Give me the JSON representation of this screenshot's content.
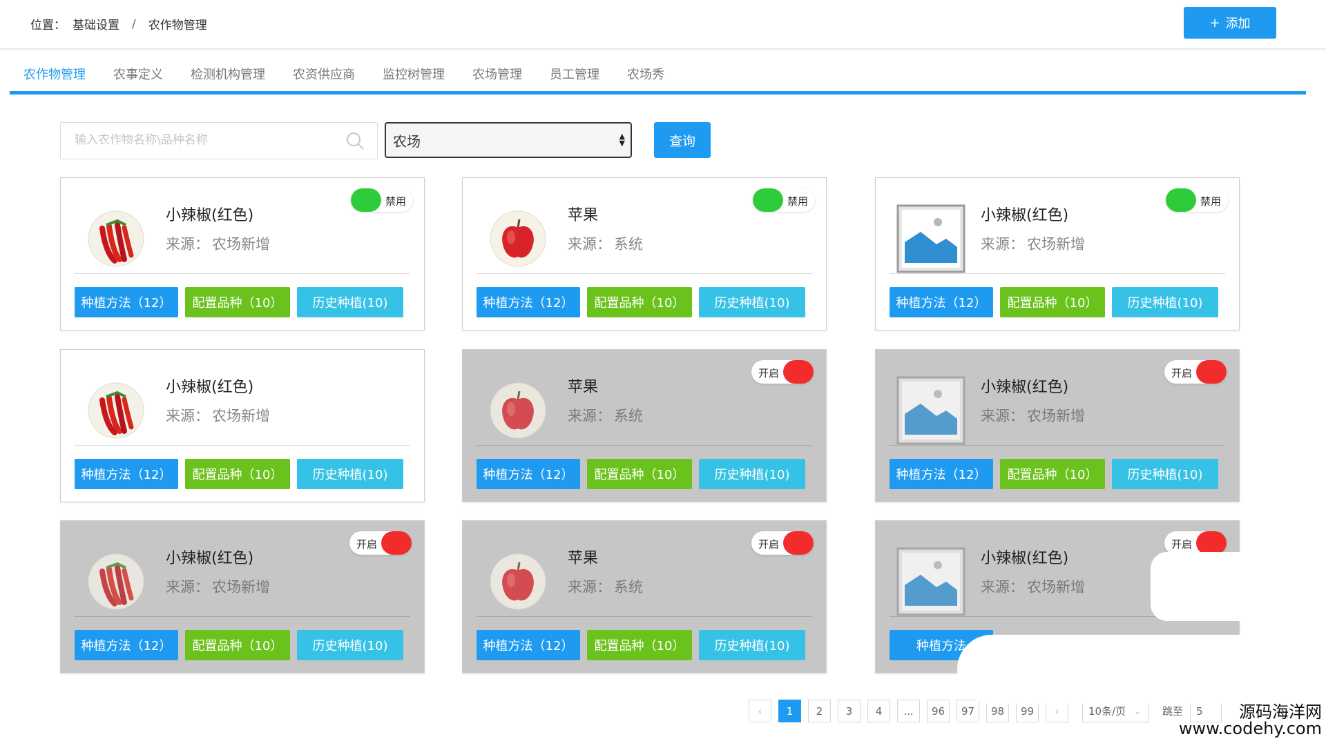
{
  "breadcrumb": {
    "prefix": "位置：",
    "items": [
      "基础设置",
      "农作物管理"
    ],
    "separator": "/"
  },
  "header": {
    "add_icon": "+",
    "add_label": "添加"
  },
  "tabs": [
    "农作物管理",
    "农事定义",
    "检测机构管理",
    "农资供应商",
    "监控树管理",
    "农场管理",
    "员工管理",
    "农场秀"
  ],
  "search": {
    "placeholder": "输入农作物名称\\品种名称",
    "icon": "search-icon"
  },
  "filter": {
    "selected": "农场"
  },
  "query_label": "查询",
  "cards": [
    {
      "name": "小辣椒(红色)",
      "src_label": "来源：",
      "src_value": "农场新增",
      "image": "chili",
      "toggle": "禁用",
      "status": "enabled",
      "btn1": "种植方法（12）",
      "btn2": "配置品种（10）",
      "btn3": "历史种植(10)"
    },
    {
      "name": "苹果",
      "src_label": "来源：",
      "src_value": "系统",
      "image": "apple",
      "toggle": "禁用",
      "status": "enabled",
      "btn1": "种植方法（12）",
      "btn2": "配置品种（10）",
      "btn3": "历史种植(10)"
    },
    {
      "name": "小辣椒(红色)",
      "src_label": "来源：",
      "src_value": "农场新增",
      "image": "placeholder",
      "toggle": "禁用",
      "status": "enabled",
      "btn1": "种植方法（12）",
      "btn2": "配置品种（10）",
      "btn3": "历史种植(10)"
    },
    {
      "name": "小辣椒(红色)",
      "src_label": "来源：",
      "src_value": "农场新增",
      "image": "chili",
      "toggle": "",
      "status": "enabled",
      "btn1": "种植方法（12）",
      "btn2": "配置品种（10）",
      "btn3": "历史种植(10)"
    },
    {
      "name": "苹果",
      "src_label": "来源：",
      "src_value": "系统",
      "image": "apple",
      "toggle": "开启",
      "status": "disabled",
      "btn1": "种植方法（12）",
      "btn2": "配置品种（10）",
      "btn3": "历史种植(10)"
    },
    {
      "name": "小辣椒(红色)",
      "src_label": "来源：",
      "src_value": "农场新增",
      "image": "placeholder",
      "toggle": "开启",
      "status": "disabled",
      "btn1": "种植方法（12）",
      "btn2": "配置品种（10）",
      "btn3": "历史种植(10)"
    },
    {
      "name": "小辣椒(红色)",
      "src_label": "来源：",
      "src_value": "农场新增",
      "image": "chili",
      "toggle": "开启",
      "status": "disabled",
      "btn1": "种植方法（12）",
      "btn2": "配置品种（10）",
      "btn3": "历史种植(10)"
    },
    {
      "name": "苹果",
      "src_label": "来源：",
      "src_value": "系统",
      "image": "apple",
      "toggle": "开启",
      "status": "disabled",
      "btn1": "种植方法（12）",
      "btn2": "配置品种（10）",
      "btn3": "历史种植(10)"
    },
    {
      "name": "小辣椒(红色)",
      "src_label": "来源：",
      "src_value": "农场新增",
      "image": "placeholder",
      "toggle": "开启",
      "status": "disabled",
      "btn1": "种植方法",
      "btn2": "",
      "btn3": ""
    }
  ],
  "pagination": {
    "prev": "‹",
    "pages": [
      "1",
      "2",
      "3",
      "4",
      "...",
      "96",
      "97",
      "98",
      "99"
    ],
    "current": "1",
    "next": "›",
    "per_page": "10条/页",
    "jump_label": "跳至",
    "jump_value": "5"
  },
  "watermark": {
    "line1": "源码海洋网",
    "line2": "www.codehy.com"
  },
  "colors": {
    "primary": "#1e9bf0",
    "green": "#6cc21d",
    "cyan": "#35c2e6",
    "toggle_on": "#2ecc3b",
    "toggle_off": "#f22b2b",
    "disabled_card": "#c6c6c6"
  }
}
